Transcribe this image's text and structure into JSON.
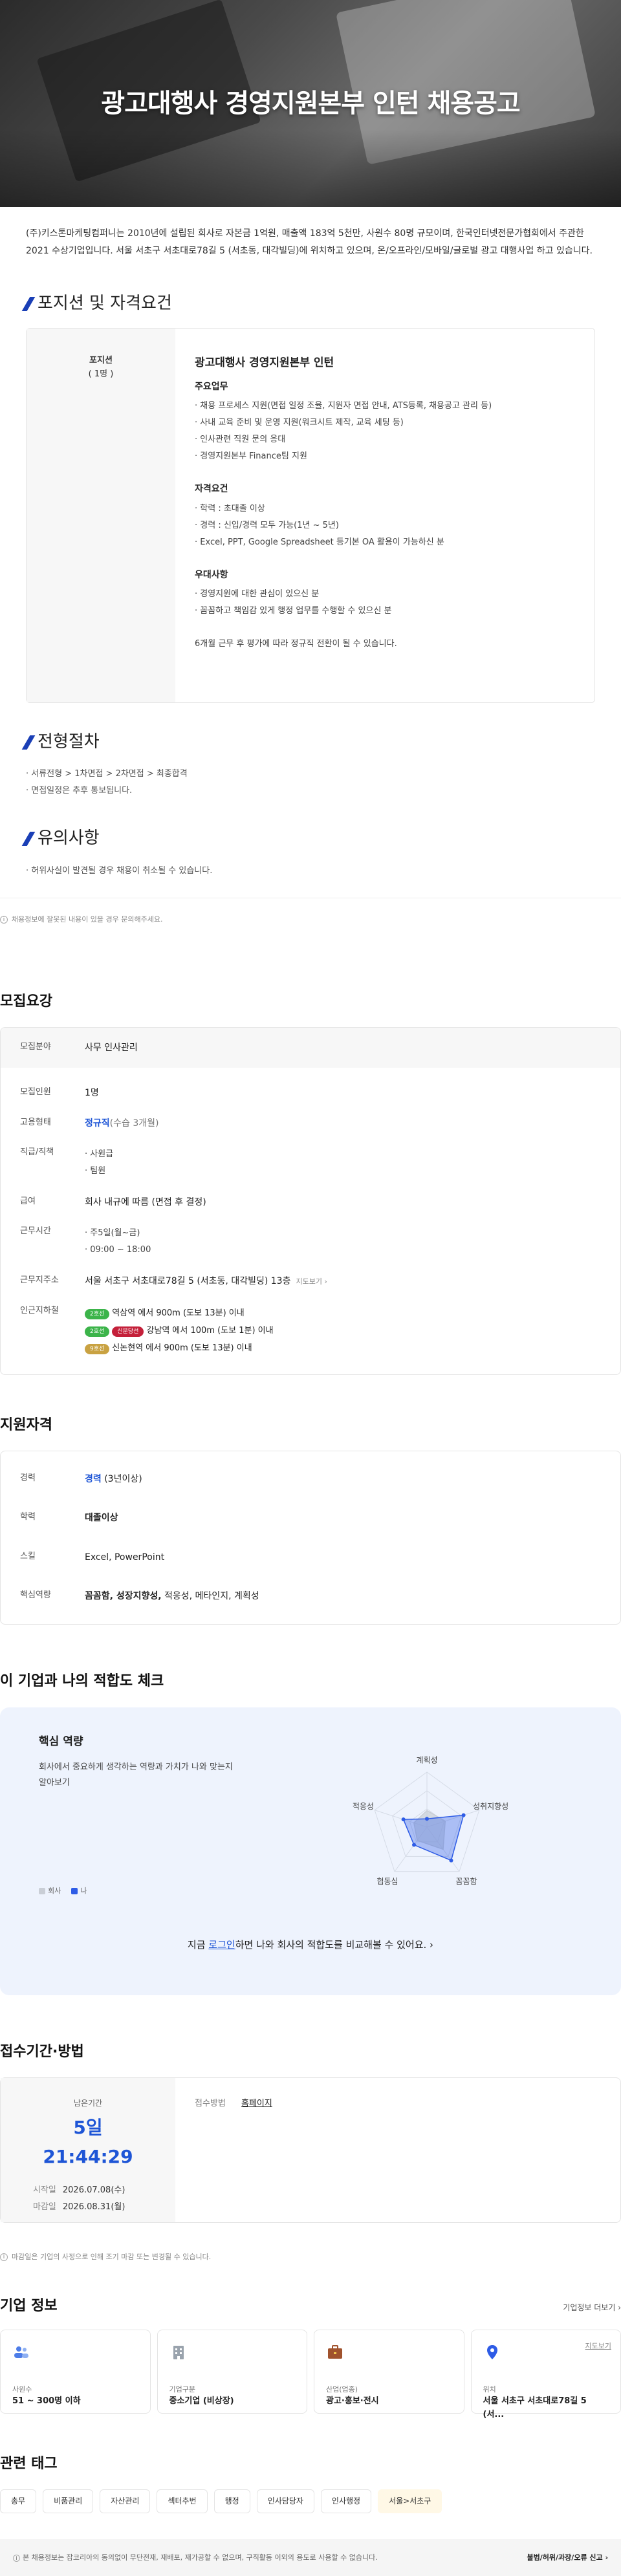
{
  "hero": {
    "title": "광고대행사 경영지원본부 인턴 채용공고"
  },
  "intro": "(주)키스톤마케팅컴퍼니는 2010년에 설립된 회사로 자본금 1억원, 매출액 183억 5천만, 사원수 80명 규모이며, 한국인터넷전문가협회에서 주관한 2021 수상기업입니다. 서울 서초구 서초대로78길 5 (서초동, 대각빌딩)에 위치하고 있으며, 온/오프라인/모바일/글로벌 광고 대행사업 하고 있습니다.",
  "positions": {
    "title": "포지션 및 자격요건",
    "left_label": "포지션",
    "left_count": "( 1명 )",
    "job_title": "광고대행사 경영지원본부 인턴",
    "duties_title": "주요업무",
    "duties": [
      "· 채용 프로세스 지원(면접 일정 조율, 지원자 면접 안내, ATS등록, 채용공고 관리 등)",
      "· 사내 교육 준비 및 운영 지원(워크시트 제작, 교육 세팅 등)",
      "· 인사관련 직원 문의 응대",
      "· 경영지원본부 Finance팀 지원"
    ],
    "req_title": "자격요건",
    "reqs": [
      "· 학력 : 초대졸 이상",
      "· 경력 : 신입/경력 모두 가능(1년 ~ 5년)",
      "· Excel, PPT, Google Spreadsheet 등기본 OA 활용이 가능하신 분"
    ],
    "pref_title": "우대사항",
    "prefs": [
      "· 경영지원에 대한 관심이 있으신 분",
      "· 꼼꼼하고 책임감 있게 행정 업무를 수행할 수 있으신 분"
    ],
    "note": "6개월 근무 후 평가에 따라 정규직 전환이 될 수 있습니다."
  },
  "process": {
    "title": "전형절차",
    "items": [
      "· 서류전형 > 1차면접 > 2차면접 > 최종합격",
      "· 면접일정은 추후 통보됩니다."
    ]
  },
  "caution": {
    "title": "유의사항",
    "items": [
      "· 허위사실이 발견될 경우 채용이 취소될 수 있습니다."
    ]
  },
  "notice": "채용정보에 잘못된 내용이 있을 경우 문의해주세요.",
  "recruit": {
    "title": "모집요강",
    "rows": [
      {
        "k": "모집분야",
        "v": "사무 인사관리"
      },
      {
        "k": "모집인원",
        "v": "1명"
      }
    ],
    "employ_k": "고용형태",
    "employ_v": "정규직",
    "employ_sub": "(수습 3개월)",
    "rank_k": "직급/직책",
    "ranks": [
      "· 사원급",
      "· 팀원"
    ],
    "salary_k": "급여",
    "salary_v": "회사 내규에 따름 (면접 후 결정)",
    "hours_k": "근무시간",
    "hours": [
      "· 주5일(월~금)",
      "· 09:00 ~ 18:00"
    ],
    "addr_k": "근무지주소",
    "addr_v": "서울 서초구 서초대로78길 5 (서초동, 대각빌딩) 13층",
    "map_label": "지도보기",
    "subway_k": "인근지하철",
    "subway": [
      {
        "lines": [
          {
            "name": "2호선",
            "color": "#3cb44a"
          }
        ],
        "text": "역삼역 에서 900m (도보 13분) 이내"
      },
      {
        "lines": [
          {
            "name": "2호선",
            "color": "#3cb44a"
          },
          {
            "name": "신분당선",
            "color": "#c4203a"
          }
        ],
        "text": "강남역 에서 100m (도보 1분) 이내"
      },
      {
        "lines": [
          {
            "name": "9호선",
            "color": "#c9a242"
          }
        ],
        "text": "신논현역 에서 900m (도보 13분) 이내"
      }
    ]
  },
  "qual": {
    "title": "지원자격",
    "career_k": "경력",
    "career_v": "경력",
    "career_sub": "(3년이상)",
    "edu_k": "학력",
    "edu_v": "대졸이상",
    "skill_k": "스킬",
    "skill_v": "Excel, PowerPoint",
    "core_k": "핵심역량",
    "core_bold": "꼼꼼함, 성장지향성,",
    "core_rest": " 적응성, 메타인지, 계획성"
  },
  "fit": {
    "title": "이 기업과 나의 적합도 체크",
    "card_title": "핵심 역량",
    "desc": "회사에서 중요하게 생각하는 역량과 가치가 나와 맞는지 알아보기",
    "legend_company": "회사",
    "legend_me": "나",
    "axes": [
      "계획성",
      "성취지향성",
      "꼼꼼함",
      "협동심",
      "적응성"
    ],
    "company_values": [
      0.3,
      0.35,
      0.5,
      0.3,
      0.25
    ],
    "me_values": [
      0.15,
      0.7,
      0.75,
      0.4,
      0.45
    ],
    "cta_pre": "지금 ",
    "cta_link": "로그인",
    "cta_post": "하면 나와 회사의 적합도를 비교해볼 수 있어요.  ›",
    "colors": {
      "me": "#2e5ce6",
      "company": "#c9ced6"
    }
  },
  "deadline": {
    "title": "접수기간·방법",
    "remain_label": "남은기간",
    "remain": "5일 21:44:29",
    "start_k": "시작일",
    "start_v": "2026.07.08(수)",
    "end_k": "마감일",
    "end_v": "2026.08.31(월)",
    "method_k": "접수방법",
    "method_v": "홈페이지",
    "notice": "마감일은 기업의 사정으로 인해 조기 마감 또는 변경될 수 있습니다."
  },
  "company": {
    "title": "기업 정보",
    "more": "기업정보 더보기  ›",
    "cards": [
      {
        "label": "사원수",
        "value": "51 ~ 300명 이하",
        "icon": "people-icon",
        "color": "#4d7de8"
      },
      {
        "label": "기업구분",
        "value": "중소기업 (비상장)",
        "icon": "building-icon",
        "color": "#9aa3ad"
      },
      {
        "label": "산업(업종)",
        "value": "광고·홍보·전시",
        "icon": "briefcase-icon",
        "color": "#a0522d"
      },
      {
        "label": "위치",
        "value": "서울 서초구 서초대로78길 5 (서...",
        "icon": "location-pin-icon",
        "color": "#2e5ce6",
        "map": "지도보기"
      }
    ]
  },
  "tags": {
    "title": "관련 태그",
    "items": [
      "총무",
      "비품관리",
      "자산관리",
      "섹터추번",
      "행정",
      "인사담당자",
      "인사행정",
      "서울>서초구"
    ]
  },
  "footer": {
    "text": "본 채용정보는 잡코리아의 동의없이 무단전재, 재배포, 재가공할 수 없으며, 구직활동 이외의 용도로 사용할 수 없습니다.",
    "report": "불법/허위/과장/오류 신고  ›"
  }
}
